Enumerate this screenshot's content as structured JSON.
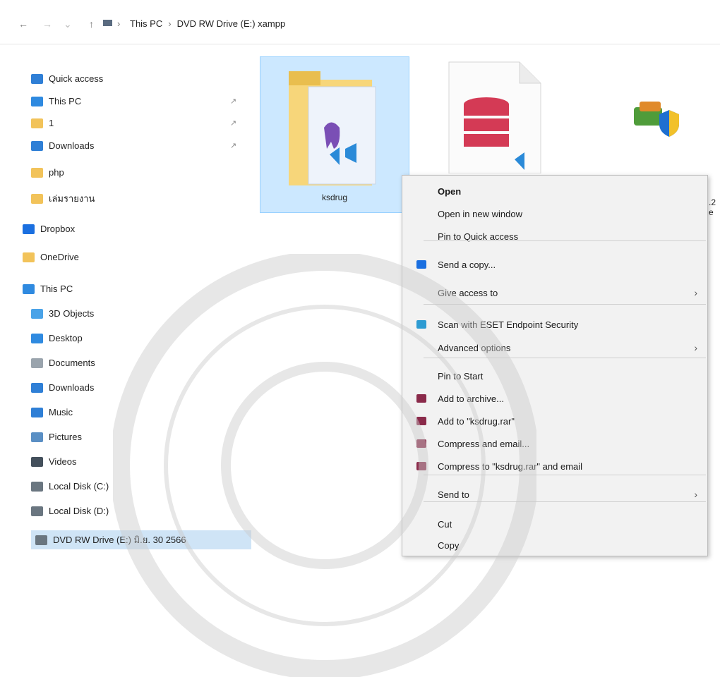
{
  "address_bar": {
    "back_icon": "arrow-left-icon",
    "forward_icon": "arrow-right-icon",
    "up_icon": "arrow-up-icon",
    "breadcrumbs": [
      "This PC",
      "DVD RW Drive (E:) xampp"
    ]
  },
  "sidebar": {
    "items": [
      {
        "label": "Quick access",
        "icon": "star-icon",
        "color": "#2f7fd6",
        "pinned": false
      },
      {
        "label": "This PC",
        "icon": "monitor-icon",
        "color": "#2f8ae0",
        "pinned": true
      },
      {
        "label": "1",
        "icon": "folder-icon",
        "color": "#f2c35a",
        "pinned": true
      },
      {
        "label": "Downloads",
        "icon": "download-icon",
        "color": "#2f7fd6",
        "pinned": true
      },
      {
        "label": "php",
        "icon": "folder-icon",
        "color": "#f2c35a",
        "pinned": false
      },
      {
        "label": "เล่มรายงาน",
        "icon": "folder-icon",
        "color": "#f2c35a",
        "pinned": false
      },
      {
        "label": "Dropbox",
        "icon": "dropbox-icon",
        "color": "#1a6fe0",
        "pinned": false
      },
      {
        "label": "OneDrive",
        "icon": "folder-icon",
        "color": "#f2c35a",
        "pinned": false
      },
      {
        "label": "This PC",
        "icon": "monitor-icon",
        "color": "#2f8ae0",
        "pinned": false
      },
      {
        "label": "3D Objects",
        "icon": "cube-icon",
        "color": "#4aa3e8",
        "pinned": false
      },
      {
        "label": "Desktop",
        "icon": "desktop-icon",
        "color": "#2f8ae0",
        "pinned": false
      },
      {
        "label": "Documents",
        "icon": "document-icon",
        "color": "#9aa4ad",
        "pinned": false
      },
      {
        "label": "Downloads",
        "icon": "download-icon",
        "color": "#2f7fd6",
        "pinned": false
      },
      {
        "label": "Music",
        "icon": "music-icon",
        "color": "#2f7fd6",
        "pinned": false
      },
      {
        "label": "Pictures",
        "icon": "picture-icon",
        "color": "#5a8fc4",
        "pinned": false
      },
      {
        "label": "Videos",
        "icon": "video-icon",
        "color": "#44505c",
        "pinned": false
      },
      {
        "label": "Local Disk (C:)",
        "icon": "disk-icon",
        "color": "#6a7680",
        "pinned": false
      },
      {
        "label": "Local Disk (D:)",
        "icon": "disk-icon",
        "color": "#6a7680",
        "pinned": false
      },
      {
        "label": "DVD RW Drive (E:) มิ.ย. 30 2566",
        "icon": "dvd-icon",
        "color": "#6a7680",
        "pinned": false
      }
    ]
  },
  "files": [
    {
      "label": "ksdrug",
      "icon": "folder-vscode-icon",
      "selected": true
    },
    {
      "label": "",
      "icon": "database-file-icon",
      "selected": false
    },
    {
      "label": "",
      "icon": "shield-app-icon",
      "selected": false
    }
  ],
  "context_menu": {
    "items": [
      {
        "label": "Open",
        "bold": true,
        "submenu": false,
        "icon": ""
      },
      {
        "label": "Open in new window",
        "bold": false,
        "submenu": false,
        "icon": ""
      },
      {
        "label": "Pin to Quick access",
        "bold": false,
        "submenu": false,
        "icon": ""
      },
      {
        "label": "Send a copy...",
        "bold": false,
        "submenu": false,
        "icon": "dropbox-icon"
      },
      {
        "label": "Give access to",
        "bold": false,
        "submenu": true,
        "icon": ""
      },
      {
        "label": "Scan with ESET Endpoint Security",
        "bold": false,
        "submenu": false,
        "icon": "eset-icon"
      },
      {
        "label": "Advanced options",
        "bold": false,
        "submenu": true,
        "icon": ""
      },
      {
        "label": "Pin to Start",
        "bold": false,
        "submenu": false,
        "icon": ""
      },
      {
        "label": "Add to archive...",
        "bold": false,
        "submenu": false,
        "icon": "winrar-icon"
      },
      {
        "label": "Add to \"ksdrug.rar\"",
        "bold": false,
        "submenu": false,
        "icon": "winrar-icon"
      },
      {
        "label": "Compress and email...",
        "bold": false,
        "submenu": false,
        "icon": "winrar-icon"
      },
      {
        "label": "Compress to \"ksdrug.rar\" and email",
        "bold": false,
        "submenu": false,
        "icon": "winrar-icon"
      },
      {
        "label": "Send to",
        "bold": false,
        "submenu": true,
        "icon": ""
      },
      {
        "label": "Cut",
        "bold": false,
        "submenu": false,
        "icon": ""
      },
      {
        "label": "Copy",
        "bold": false,
        "submenu": false,
        "icon": ""
      }
    ]
  },
  "colors": {
    "selection": "#cce8ff",
    "menu_bg": "#f2f2f2"
  }
}
